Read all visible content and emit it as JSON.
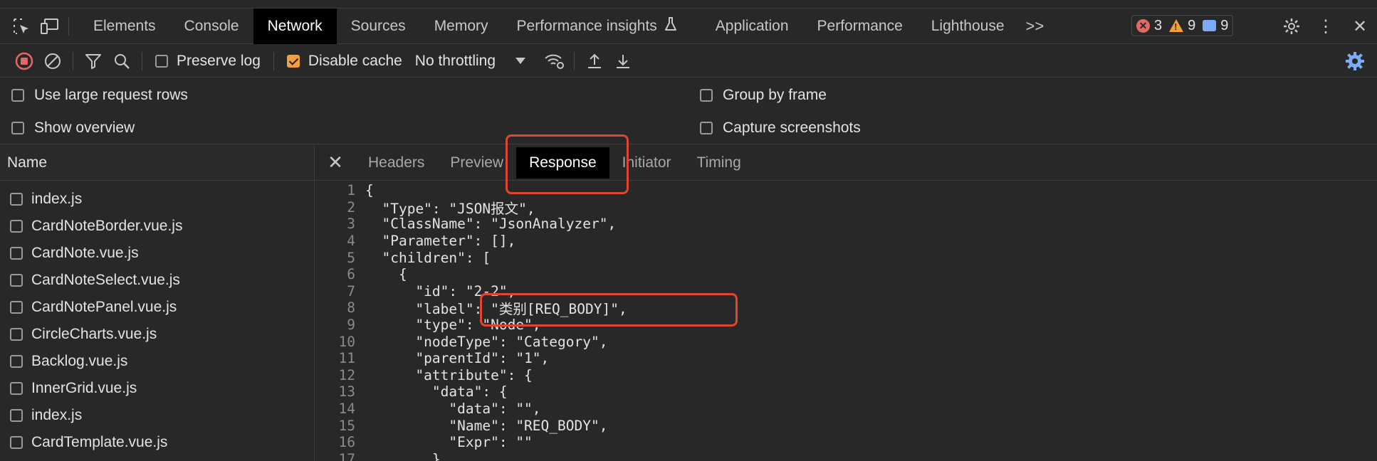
{
  "main_tabs": [
    {
      "label": "Elements",
      "active": false
    },
    {
      "label": "Console",
      "active": false
    },
    {
      "label": "Network",
      "active": true
    },
    {
      "label": "Sources",
      "active": false
    },
    {
      "label": "Memory",
      "active": false
    },
    {
      "label": "Performance insights",
      "active": false
    },
    {
      "label": "Application",
      "active": false
    },
    {
      "label": "Performance",
      "active": false
    },
    {
      "label": "Lighthouse",
      "active": false
    }
  ],
  "more_tabs": ">>",
  "badges": {
    "errors": "3",
    "warnings": "9",
    "messages": "9"
  },
  "toolbar": {
    "preserve_log": {
      "label": "Preserve log",
      "checked": false
    },
    "disable_cache": {
      "label": "Disable cache",
      "checked": true
    },
    "throttling": "No throttling"
  },
  "settings": {
    "large_rows": "Use large request rows",
    "show_overview": "Show overview",
    "group_by_frame": "Group by frame",
    "capture_screenshots": "Capture screenshots"
  },
  "name_column": "Name",
  "requests": [
    "index.js",
    "CardNoteBorder.vue.js",
    "CardNote.vue.js",
    "CardNoteSelect.vue.js",
    "CardNotePanel.vue.js",
    "CircleCharts.vue.js",
    "Backlog.vue.js",
    "InnerGrid.vue.js",
    "index.js",
    "CardTemplate.vue.js"
  ],
  "detail_tabs": [
    {
      "label": "Headers",
      "active": false
    },
    {
      "label": "Preview",
      "active": false
    },
    {
      "label": "Response",
      "active": true
    },
    {
      "label": "Initiator",
      "active": false
    },
    {
      "label": "Timing",
      "active": false
    }
  ],
  "response_lines": [
    {
      "n": "1",
      "text": "{"
    },
    {
      "n": "2",
      "text": "  \"Type\": \"JSON报文\","
    },
    {
      "n": "3",
      "text": "  \"ClassName\": \"JsonAnalyzer\","
    },
    {
      "n": "4",
      "text": "  \"Parameter\": [],"
    },
    {
      "n": "5",
      "text": "  \"children\": ["
    },
    {
      "n": "6",
      "text": "    {"
    },
    {
      "n": "7",
      "text": "      \"id\": \"2-2\","
    },
    {
      "n": "8",
      "text": "      \"label\": \"类别[REQ_BODY]\","
    },
    {
      "n": "9",
      "text": "      \"type\": \"Node\","
    },
    {
      "n": "10",
      "text": "      \"nodeType\": \"Category\","
    },
    {
      "n": "11",
      "text": "      \"parentId\": \"1\","
    },
    {
      "n": "12",
      "text": "      \"attribute\": {"
    },
    {
      "n": "13",
      "text": "        \"data\": {"
    },
    {
      "n": "14",
      "text": "          \"data\": \"\","
    },
    {
      "n": "15",
      "text": "          \"Name\": \"REQ_BODY\","
    },
    {
      "n": "16",
      "text": "          \"Expr\": \"\""
    },
    {
      "n": "17",
      "text": "        },"
    }
  ],
  "colors": {
    "highlight": "#e0452e",
    "checkbox_on": "#f2a03d",
    "record": "#e46962",
    "settings_blue": "#7cacf8"
  }
}
